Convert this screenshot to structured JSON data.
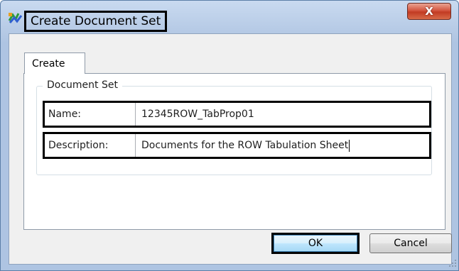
{
  "window": {
    "title": "Create Document Set",
    "close_glyph": "X"
  },
  "tabs": [
    {
      "label": "Create"
    }
  ],
  "group": {
    "legend": "Document Set"
  },
  "fields": {
    "name": {
      "label": "Name:",
      "value": "12345ROW_TabProp01"
    },
    "description": {
      "label": "Description:",
      "value": "Documents for the ROW Tabulation Sheet"
    }
  },
  "buttons": {
    "ok_label": "OK",
    "cancel_label": "Cancel"
  },
  "icons": {
    "app": "app-icon",
    "close": "close-icon",
    "resize": "resize-grip-icon"
  }
}
